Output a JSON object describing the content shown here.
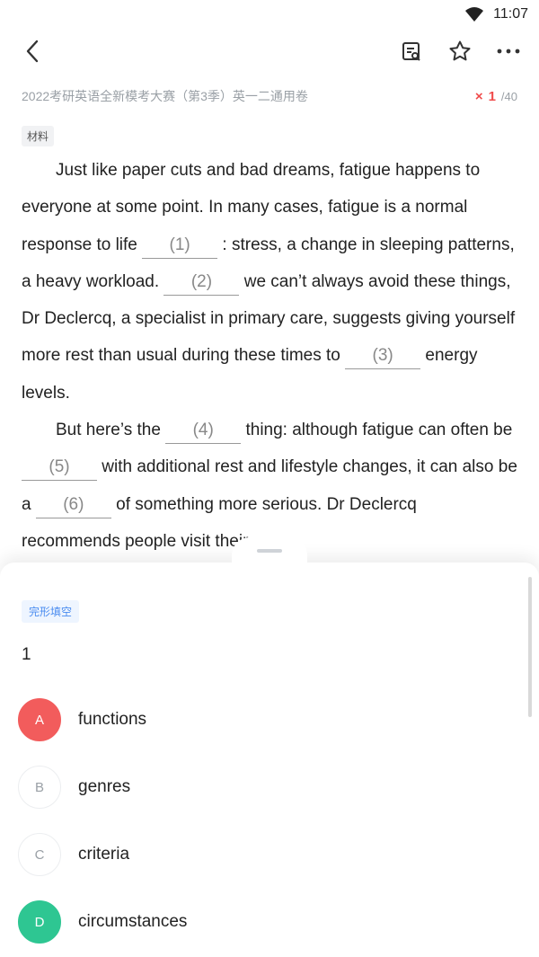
{
  "status": {
    "time": "11:07"
  },
  "exam": {
    "title": "2022考研英语全新模考大赛（第3季）英一二通用卷",
    "progress_mark": "×",
    "current": "1",
    "total": "/40"
  },
  "material_label": "材料",
  "passage": {
    "p1_a": "Just like paper cuts and bad dreams, fatigue happens to everyone at some point. In many cases, fatigue is a normal response to life",
    "blank1": "(1)",
    "p1_b": ": stress, a change in sleeping patterns, a heavy workload.",
    "blank2": "(2)",
    "p1_c": "we can’t always avoid these things, Dr Declercq, a specialist in primary care, suggests giving yourself more rest than usual during these times to",
    "blank3": "(3)",
    "p1_d": "energy levels.",
    "p2_a": "But here’s the",
    "blank4": "(4)",
    "p2_b": "thing: although fatigue can often be",
    "blank5": "(5)",
    "p2_c": "with additional rest and lifestyle changes, it can also be a",
    "blank6": "(6)",
    "p2_d": "of something more serious. Dr Declercq recommends people visit their"
  },
  "question": {
    "type_label": "完形填空",
    "number": "1",
    "options": [
      {
        "letter": "A",
        "text": "functions",
        "state": "wrong"
      },
      {
        "letter": "B",
        "text": "genres",
        "state": "none"
      },
      {
        "letter": "C",
        "text": "criteria",
        "state": "none"
      },
      {
        "letter": "D",
        "text": "circumstances",
        "state": "correct"
      }
    ]
  },
  "colors": {
    "wrong": "#f25c5c",
    "correct": "#2ec692",
    "accent": "#4a8cf0"
  },
  "icons": [
    "wifi-icon",
    "back-arrow-icon",
    "answer-sheet-icon",
    "star-icon",
    "more-icon"
  ]
}
